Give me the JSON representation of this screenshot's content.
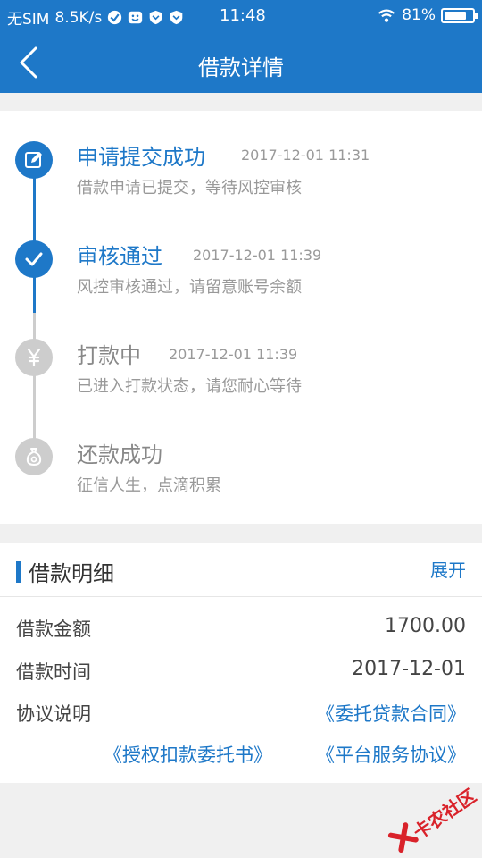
{
  "status_bar": {
    "carrier": "无SIM",
    "speed": "8.5K/s",
    "time": "11:48",
    "battery": "81%",
    "battery_level": 0.81,
    "icons": [
      "check-circle-icon",
      "bear-app-icon",
      "shield-icon",
      "shield-icon",
      "wifi-icon",
      "battery-icon"
    ]
  },
  "header": {
    "title": "借款详情",
    "back_icon": "chevron-left-icon"
  },
  "timeline": {
    "steps": [
      {
        "title": "申请提交成功",
        "time": "2017-12-01 11:31",
        "desc": "借款申请已提交，等待风控审核",
        "state": "done",
        "icon": "edit-icon"
      },
      {
        "title": "审核通过",
        "time": "2017-12-01 11:39",
        "desc": "风控审核通过，请留意账号余额",
        "state": "done",
        "icon": "check-icon"
      },
      {
        "title": "打款中",
        "time": "2017-12-01 11:39",
        "desc": "已进入打款状态，请您耐心等待",
        "state": "pending",
        "icon": "yen-icon"
      },
      {
        "title": "还款成功",
        "time": "",
        "desc": "征信人生，点滴积累",
        "state": "pending",
        "icon": "money-bag-icon"
      }
    ]
  },
  "loan_detail": {
    "section_title": "借款明细",
    "expand_label": "展开",
    "rows": [
      {
        "label": "借款金额",
        "value": "1700.00"
      },
      {
        "label": "借款时间",
        "value": "2017-12-01"
      },
      {
        "label": "协议说明",
        "value": "《委托贷款合同》"
      }
    ],
    "agreements": [
      "《授权扣款委托书》",
      "《平台服务协议》"
    ]
  },
  "watermark": {
    "text": "卡农社区"
  },
  "colors": {
    "primary": "#1e78c8",
    "pending": "#cdcdcd",
    "text_muted": "#999999",
    "background": "#f0f0f0"
  }
}
